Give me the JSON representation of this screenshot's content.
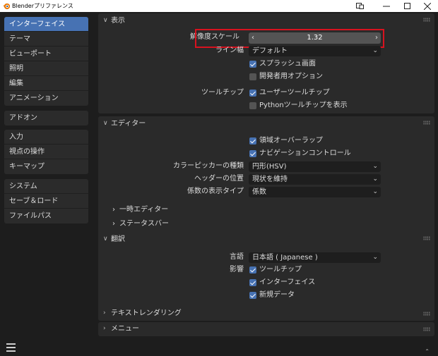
{
  "window": {
    "title": "Blenderプリファレンス"
  },
  "sidebar": {
    "groups": [
      [
        "インターフェイス",
        "テーマ",
        "ビューポート",
        "照明",
        "編集",
        "アニメーション"
      ],
      [
        "アドオン"
      ],
      [
        "入力",
        "視点の操作",
        "キーマップ"
      ],
      [
        "システム",
        "セーブ＆ロード",
        "ファイルパス"
      ]
    ],
    "active": "インターフェイス"
  },
  "display": {
    "header": "表示",
    "resolution_scale": {
      "label": "解像度スケール",
      "value": "1.32"
    },
    "line_width": {
      "label": "ライン幅",
      "value": "デフォルト"
    },
    "splash": {
      "label": "スプラッシュ画面",
      "checked": true
    },
    "dev_options": {
      "label": "開発者用オプション",
      "checked": false
    },
    "tooltips": {
      "label": "ツールチップ",
      "user": "ユーザーツールチップ",
      "python": "Pythonツールチップを表示"
    }
  },
  "editors": {
    "header": "エディター",
    "region_overlap": "領域オーバーラップ",
    "nav_controls": "ナビゲーションコントロール",
    "color_picker": {
      "label": "カラーピッカーの種類",
      "value": "円形(HSV)"
    },
    "header_pos": {
      "label": "ヘッダーの位置",
      "value": "現状を維持"
    },
    "factor_display": {
      "label": "係数の表示タイプ",
      "value": "係数"
    },
    "temp_editors": "一時エディター",
    "status_bar": "ステータスバー"
  },
  "translation": {
    "header": "翻訳",
    "language": {
      "label": "言語",
      "value": "日本語 ( Japanese )"
    },
    "affect": {
      "label": "影響",
      "tooltips": "ツールチップ",
      "interface": "インターフェイス",
      "new_data": "新規データ"
    }
  },
  "text_rendering": {
    "header": "テキストレンダリング"
  },
  "menus": {
    "header": "メニュー"
  },
  "colors": {
    "accent": "#4772b3",
    "highlight": "#d8121f",
    "panel": "#2a2a2a",
    "background": "#1d1d1d"
  }
}
